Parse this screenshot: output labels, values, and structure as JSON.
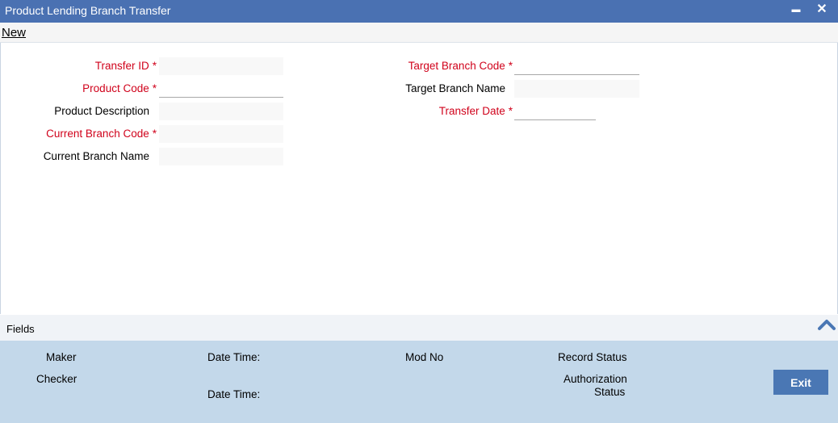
{
  "window": {
    "title": "Product Lending Branch Transfer",
    "minimize_glyph": "▬",
    "close_glyph": "✕"
  },
  "menubar": {
    "new_label": "New"
  },
  "form": {
    "required_mark": "*",
    "transfer_id": {
      "label": "Transfer ID",
      "value": ""
    },
    "product_code": {
      "label": "Product Code",
      "value": ""
    },
    "product_description": {
      "label": "Product Description",
      "value": ""
    },
    "current_branch_code": {
      "label": "Current Branch Code",
      "value": ""
    },
    "current_branch_name": {
      "label": "Current Branch Name",
      "value": ""
    },
    "target_branch_code": {
      "label": "Target Branch Code",
      "value": ""
    },
    "target_branch_name": {
      "label": "Target Branch Name",
      "value": ""
    },
    "transfer_date": {
      "label": "Transfer Date",
      "value": ""
    }
  },
  "fields_bar": {
    "label": "Fields",
    "icon": "chevron-up-icon"
  },
  "footer": {
    "maker": "Maker",
    "checker": "Checker",
    "date_time_1": "Date Time:",
    "date_time_2": "Date Time:",
    "mod_no": "Mod No",
    "record_status": "Record Status",
    "authorization_line1": "Authorization",
    "authorization_line2": "Status",
    "exit_label": "Exit"
  },
  "colors": {
    "titlebar": "#4a71b2",
    "required": "#d0021b",
    "footer": "#c3d8ea",
    "exit_button": "#4a77b4"
  }
}
